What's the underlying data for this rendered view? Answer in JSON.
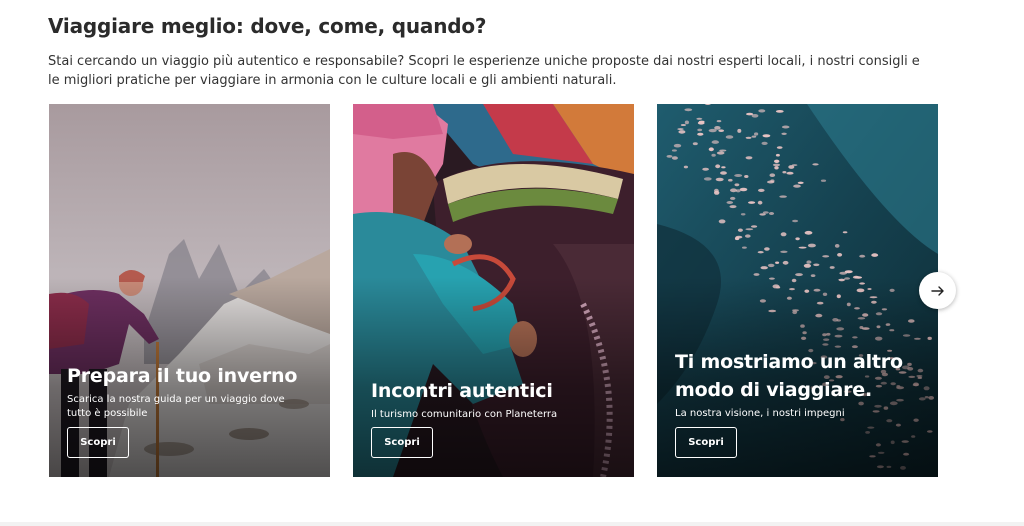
{
  "section": {
    "title": "Viaggiare meglio: dove, come, quando?",
    "description": "Stai cercando un viaggio più autentico e responsabile? Scopri le esperienze uniche proposte dai nostri esperti locali, i nostri consigli e le migliori pratiche per viaggiare in armonia con le culture locali e gli ambienti naturali."
  },
  "cards": [
    {
      "title": "Prepara il tuo inverno",
      "subtitle": "Scarica la nostra guida per un viaggio dove tutto è possibile",
      "button": "Scopri",
      "image": "snowy-mountain-hiker"
    },
    {
      "title": "Incontri autentici",
      "subtitle": "Il turismo comunitario con Planeterra",
      "button": "Scopri",
      "image": "weaver-textile"
    },
    {
      "title": "Ti mostriamo un altro modo di viaggiare.",
      "subtitle": "La nostra visione, i nostri impegni",
      "button": "Scopri",
      "image": "flamingos-lake"
    }
  ],
  "carousel": {
    "next_icon": "arrow-right-icon"
  }
}
